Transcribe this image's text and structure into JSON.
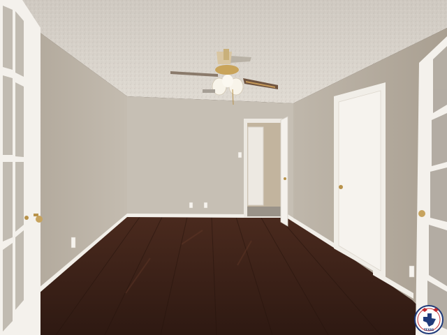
{
  "scene": {
    "subject": "empty-room-photo",
    "colors": {
      "ceiling": "#d9d3cb",
      "wall_back": "#c9c2b7",
      "wall_left": "#bdb5a9",
      "wall_right": "#b3aa9d",
      "floor": "#3b2218",
      "floor_light": "#5a3426",
      "trim": "#f2efe9",
      "door": "#f4f1ec",
      "brass": "#b8924a"
    },
    "icons": [
      "ceiling-fan-icon",
      "electrical-outlet-icon",
      "light-switch-icon",
      "door-knob-icon",
      "logo-seal-icon"
    ]
  },
  "watermark": {
    "badge_text": "TEXAS",
    "shape": "round-seal"
  }
}
